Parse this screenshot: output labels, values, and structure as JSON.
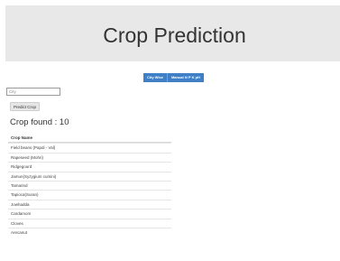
{
  "header": {
    "title": "Crop Prediction"
  },
  "toolbar": {
    "city_wise_label": "City Wise",
    "manual_label": "Manual N P K pH"
  },
  "form": {
    "city_placeholder": "City",
    "predict_label": "Predict Crop"
  },
  "results": {
    "found_text": "Crop found : 10",
    "column_header": "Crop Name",
    "rows": [
      "Field beans (Papdi - Val)",
      "Rapeseed (Mohri)",
      "Ridgegourd",
      "Jamun(Syzygium cumini)",
      "Tamarind",
      "Tapioca(Suran)",
      "Jowhadda",
      "Cardamom",
      "Cloves",
      "Arecanut"
    ]
  }
}
